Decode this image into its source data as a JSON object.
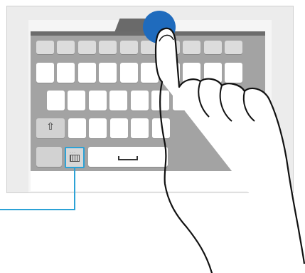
{
  "device": {
    "frame_color": "#ececec",
    "keyboard_color": "#a3a3a3",
    "key_color": "#ffffff"
  },
  "keyboard": {
    "rows": [
      {
        "name": "number-row",
        "count": 10
      },
      {
        "name": "top-letter-row",
        "count": 10
      },
      {
        "name": "middle-letter-row",
        "count": 9
      },
      {
        "name": "bottom-letter-row",
        "count": 7
      },
      {
        "name": "bottom-function-row",
        "count": 3
      }
    ],
    "shift_symbol": "⇧",
    "mode_key_icon": "keyboard-mode-icon",
    "space_icon": "space-bar-icon"
  },
  "gesture": {
    "type": "tap-and-hold",
    "touch_color": "#1f6bbd",
    "callout_color": "#2ca2d6"
  }
}
